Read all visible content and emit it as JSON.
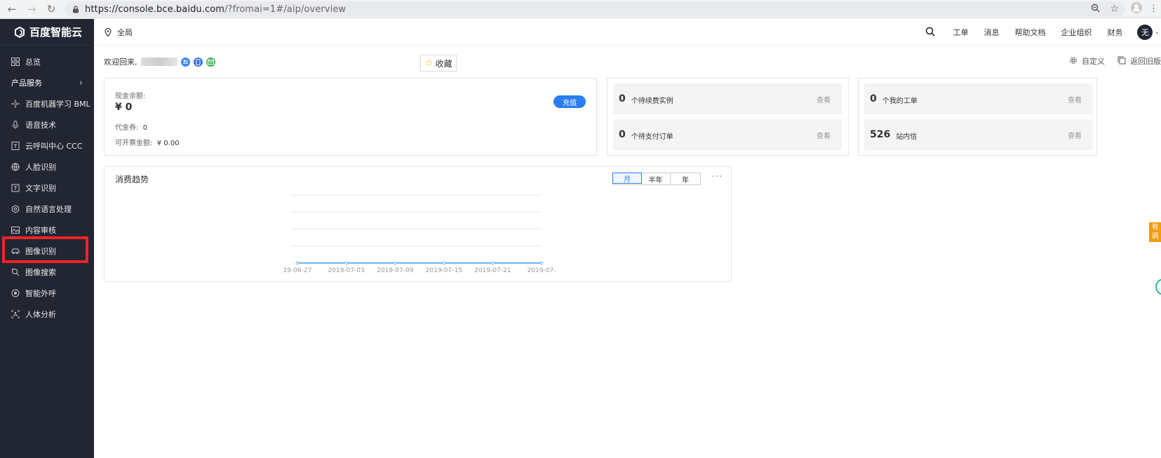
{
  "browser": {
    "url_host": "https://console.bce.baidu.com",
    "url_rest": "/?fromai=1#/aip/overview"
  },
  "sidebar": {
    "logo_text": "百度智能云",
    "overview": "总览",
    "section_title": "产品服务",
    "items": [
      {
        "label": "百度机器学习 BML",
        "icon": "network-icon"
      },
      {
        "label": "语音技术",
        "icon": "microphone-icon"
      },
      {
        "label": "云呼叫中心 CCC",
        "icon": "phone-box-icon"
      },
      {
        "label": "人脸识别",
        "icon": "globe-icon"
      },
      {
        "label": "文字识别",
        "icon": "text-box-icon"
      },
      {
        "label": "自然语言处理",
        "icon": "hexagon-icon"
      },
      {
        "label": "内容审核",
        "icon": "image-icon"
      },
      {
        "label": "图像识别",
        "icon": "car-icon"
      },
      {
        "label": "图像搜索",
        "icon": "image-search-icon"
      },
      {
        "label": "智能外呼",
        "icon": "outbound-call-icon"
      },
      {
        "label": "人体分析",
        "icon": "body-scan-icon"
      }
    ]
  },
  "header": {
    "region": "全局",
    "links": [
      "工单",
      "消息",
      "帮助文档",
      "企业组织",
      "财务"
    ],
    "avatar": "无"
  },
  "welcome": {
    "text": "欢迎回来,",
    "favorite": "收藏",
    "customize": "自定义",
    "back_old": "返回旧版"
  },
  "balance": {
    "cash_label": "现金余额:",
    "cash_value": "¥ 0",
    "recharge": "充值",
    "voucher_label": "代金券:",
    "voucher_value": "0",
    "invoice_label": "可开票金额:",
    "invoice_value": "¥ 0.00"
  },
  "stats": [
    {
      "num": "0",
      "label": "个待续费实例",
      "action": "查看"
    },
    {
      "num": "0",
      "label": "个待支付订单",
      "action": "查看"
    },
    {
      "num": "0",
      "label": "个我的工单",
      "action": "查看"
    },
    {
      "num": "526",
      "label": "站内信",
      "action": "查看"
    }
  ],
  "trend": {
    "title": "消费趋势",
    "tabs": [
      "月",
      "半年",
      "年"
    ],
    "active_tab": "月",
    "more": "···"
  },
  "float_tab": {
    "line1": "有",
    "line2": "调"
  },
  "colors": {
    "sidebar_bg": "#222633",
    "accent": "#2a7ef0",
    "highlight": "#f02424",
    "line": "#6ab2ee",
    "float_tab": "#f29b0f"
  },
  "chart_data": {
    "type": "line",
    "x": [
      "19-06-27",
      "2019-07-03",
      "2019-07-09",
      "2019-07-15",
      "2019-07-21",
      "2019-07-"
    ],
    "series": [
      {
        "values": [
          0,
          0,
          0,
          0,
          0,
          0
        ]
      }
    ],
    "ylim": [
      0,
      4
    ],
    "grid": true
  }
}
